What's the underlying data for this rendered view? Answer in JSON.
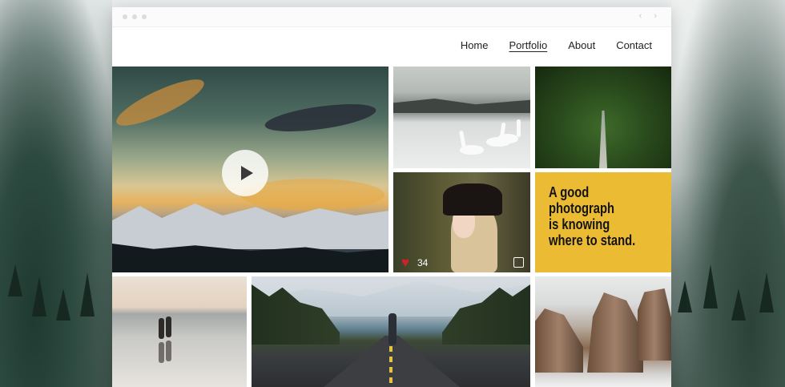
{
  "nav": {
    "items": [
      "Home",
      "Portfolio",
      "About",
      "Contact"
    ],
    "active": "Portfolio"
  },
  "tiles": {
    "video": {
      "play_icon": "play-icon"
    },
    "woman": {
      "likes": "34",
      "like_icon": "heart-icon",
      "share_icon": "share-icon"
    },
    "quote": {
      "text": "A good photograph\nis knowing\nwhere to stand."
    }
  },
  "window": {
    "controls_icon": "chevron-left-right-icon"
  },
  "colors": {
    "quote_bg": "#ebbb34",
    "heart": "#d0212b"
  }
}
